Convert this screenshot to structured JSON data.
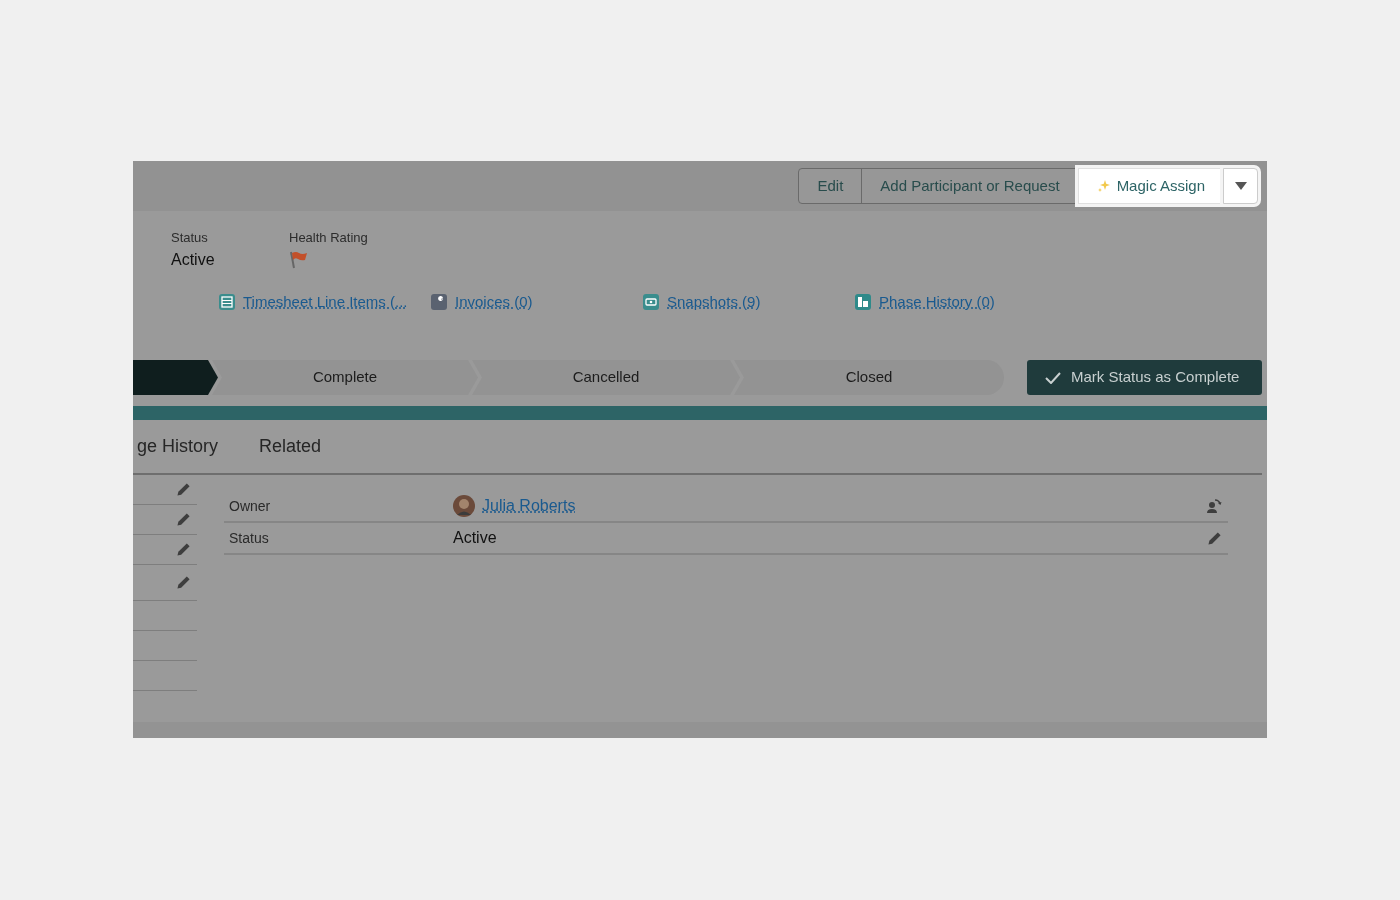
{
  "header_buttons": [
    {
      "label": "Edit",
      "highlighted": false
    },
    {
      "label": "Add Participant or Request",
      "highlighted": false
    },
    {
      "label": "Magic Assign",
      "highlighted": true
    }
  ],
  "highlights": [
    {
      "label": "Status",
      "value": "Active",
      "kind": "text"
    },
    {
      "label": "Health Rating",
      "kind": "flag"
    }
  ],
  "related_links": [
    {
      "label": "Timesheet Line Items (...",
      "color": "#3a8d8d"
    },
    {
      "label": "Invoices (0)",
      "color": "#5a6270"
    },
    {
      "label": "Snapshots (9)",
      "color": "#3a8d8d"
    },
    {
      "label": "Phase History (0)",
      "color": "#2f8a8a"
    }
  ],
  "path_stages": [
    {
      "selected": true
    },
    {
      "label": "Complete",
      "selected": false
    },
    {
      "label": "Cancelled",
      "selected": false
    },
    {
      "label": "Closed",
      "selected": false
    }
  ],
  "mark_button": "Mark Status as Complete",
  "tabs": [
    {
      "label": "ge History"
    },
    {
      "label": "Related"
    }
  ],
  "left_rows": [
    {
      "editable": true
    },
    {
      "editable": true
    },
    {
      "editable": true
    },
    {
      "editable": true
    },
    {
      "editable": false
    },
    {
      "editable": false
    },
    {
      "editable": false
    }
  ],
  "fields": [
    {
      "label": "Owner",
      "value": "Julia Roberts",
      "kind": "user"
    },
    {
      "label": "Status",
      "value": "Active",
      "kind": "text"
    }
  ]
}
